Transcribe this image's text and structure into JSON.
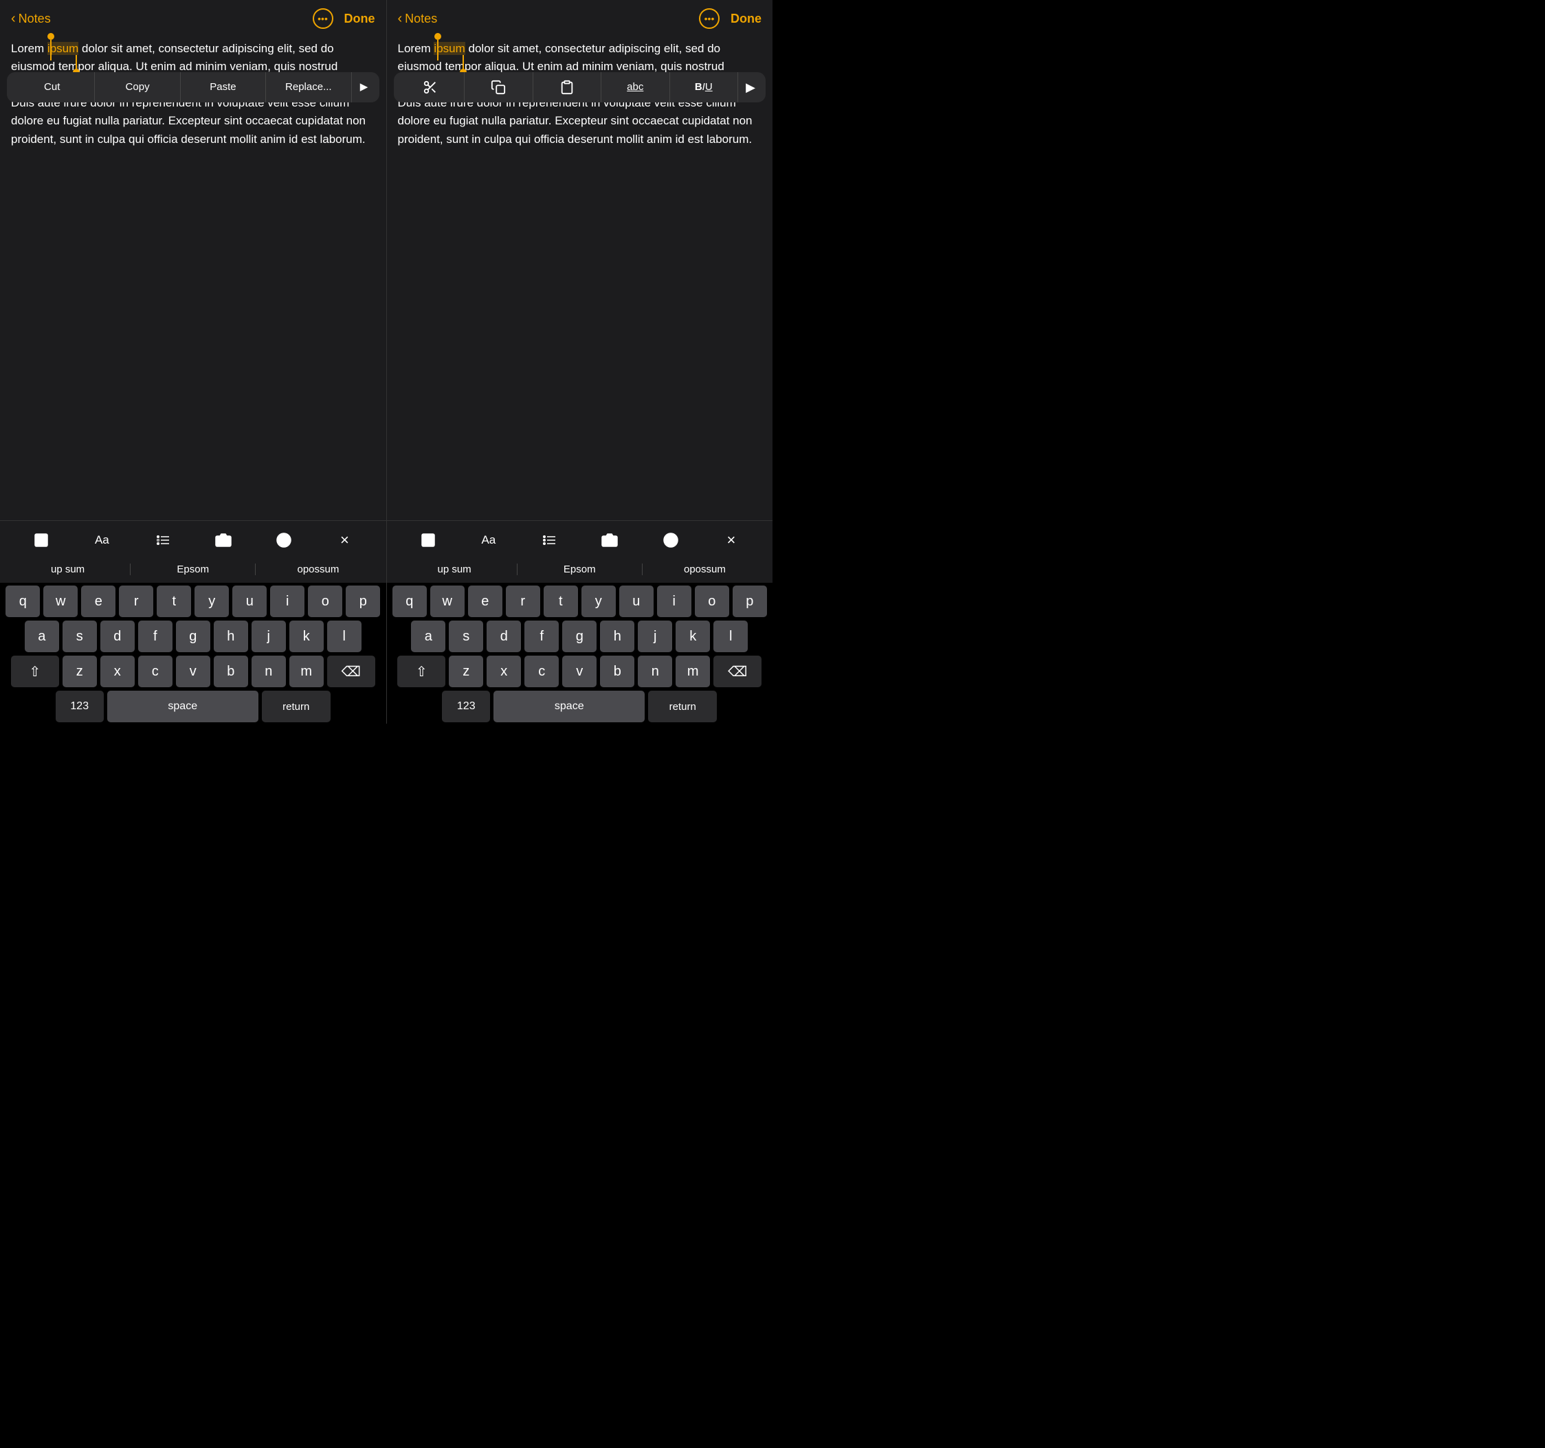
{
  "left_panel": {
    "nav": {
      "back_label": "Notes",
      "ellipsis_dots": "···",
      "done_label": "Done"
    },
    "note_text": {
      "before": "Lorem ",
      "selected": "ipsum",
      "after": " dolor sit amet, consectetur adipiscing elit, sed do eiusmod tempor aliqua. Ut enim ad minim veniam, quis nostrud exercitation ullamco laboris nisi ut aliquip ex ea commodo consequat. Duis aute irure dolor in reprehenderit in voluptate velit esse cillum dolore eu fugiat nulla pariatur. Excepteur sint occaecat cupidatat non proident, sunt in culpa qui officia deserunt mollit anim id est laborum."
    },
    "context_menu": {
      "cut": "Cut",
      "copy": "Copy",
      "paste": "Paste",
      "replace": "Replace...",
      "arrow": "▶"
    },
    "toolbar": {
      "table_icon": "table",
      "font_icon": "Aa",
      "list_icon": "list",
      "camera_icon": "camera",
      "markup_icon": "markup",
      "close_icon": "×"
    },
    "predictive": [
      "up sum",
      "Epsom",
      "opossum"
    ],
    "keys_row1": [
      "q",
      "w",
      "e",
      "r",
      "t",
      "y",
      "u",
      "i",
      "o",
      "p"
    ],
    "keys_row2": [
      "a",
      "s",
      "d",
      "f",
      "g",
      "h",
      "j",
      "k",
      "l"
    ],
    "keys_row3": [
      "z",
      "x",
      "c",
      "v",
      "b",
      "n",
      "m"
    ],
    "bottom_keys": {
      "num": "123",
      "space": "space",
      "return": "return"
    }
  },
  "right_panel": {
    "nav": {
      "back_label": "Notes",
      "ellipsis_dots": "···",
      "done_label": "Done"
    },
    "note_text": {
      "before": "Lorem ",
      "selected": "ipsum",
      "after": " dolor sit amet, consectetur adipiscing elit, sed do eiusmod tempor aliqua. Ut enim ad minim veniam, quis nostrud exercitation ullamco laboris nisi ut aliquip ex ea commodo consequat. Duis aute irure dolor in reprehenderit in voluptate velit esse cillum dolore eu fugiat nulla pariatur. Excepteur sint occaecat cupidatat non proident, sunt in culpa qui officia deserunt mollit anim id est laborum."
    },
    "context_menu": {
      "cut_icon": "✂",
      "copy_icon": "⧉",
      "paste_icon": "📋",
      "abc_label": "abc",
      "biu_label": "BIU",
      "arrow": "▶"
    },
    "toolbar": {
      "table_icon": "table",
      "font_icon": "Aa",
      "list_icon": "list",
      "camera_icon": "camera",
      "markup_icon": "markup",
      "close_icon": "×"
    },
    "predictive": [
      "up sum",
      "Epsom",
      "opossum"
    ],
    "keys_row1": [
      "q",
      "w",
      "e",
      "r",
      "t",
      "y",
      "u",
      "i",
      "o",
      "p"
    ],
    "keys_row2": [
      "a",
      "s",
      "d",
      "f",
      "g",
      "h",
      "j",
      "k",
      "l"
    ],
    "keys_row3": [
      "z",
      "x",
      "c",
      "v",
      "b",
      "n",
      "m"
    ],
    "bottom_keys": {
      "num": "123",
      "space": "space",
      "return": "return"
    }
  }
}
